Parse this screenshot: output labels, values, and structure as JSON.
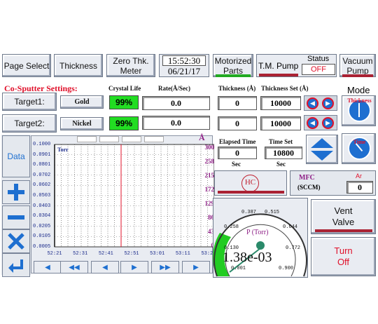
{
  "header": {
    "page_select": "Page Select",
    "thickness": "Thickness",
    "zero_thk_line1": "Zero Thk.",
    "zero_thk_line2": "Meter",
    "time": "15:52:30",
    "date": "06/21/17",
    "motorized_line1": "Motorized",
    "motorized_line2": "Parts",
    "tm_pump": "T.M. Pump",
    "status_label": "Status",
    "status_value": "OFF",
    "vacuum_line1": "Vacuum",
    "vacuum_line2": "Pump"
  },
  "cosputter": {
    "title": "Co-Sputter Settings:",
    "col_crystal_life": "Crystal Life",
    "col_rate": "Rate(Å/Sec)",
    "col_thickness": "Thickness (Å)",
    "col_thickness_set": "Thickness Set (Å)",
    "mode_label": "Mode",
    "mode_thickness_label": "Thickness",
    "targets": [
      {
        "label": "Target1:",
        "material": "Gold",
        "crystal_life": "99%",
        "rate": "0.0",
        "thickness": "0",
        "thickness_set": "10000"
      },
      {
        "label": "Target2:",
        "material": "Nickel",
        "crystal_life": "99%",
        "rate": "0.0",
        "thickness": "0",
        "thickness_set": "10000"
      }
    ]
  },
  "side_buttons": {
    "data": "Data"
  },
  "chart_data": {
    "type": "line",
    "title": "",
    "series": [],
    "ylabel": "Torr",
    "y_ticks": [
      "0.1000",
      "0.0901",
      "0.0801",
      "0.0702",
      "0.0602",
      "0.0503",
      "0.0403",
      "0.0304",
      "0.0205",
      "0.0105",
      "0.0005"
    ],
    "y2_label": "Å",
    "y2_ticks": [
      "300",
      "258",
      "215",
      "172",
      "129",
      "86",
      "43",
      "0"
    ],
    "x_ticks": [
      "52:21",
      "52:31",
      "52:41",
      "52:51",
      "53:01",
      "53:11",
      "53:21"
    ],
    "grid": true
  },
  "timing": {
    "elapsed_label": "Elapsed Time",
    "elapsed_value": "0",
    "elapsed_unit": "Sec",
    "timeset_label": "Time Set",
    "timeset_value": "10800",
    "timeset_unit": "Sec",
    "time_mode_label": "Time"
  },
  "hc_label": "HC",
  "mfc": {
    "label": "MFC",
    "unit": "(SCCM)",
    "gas": "Ar",
    "value": "0"
  },
  "gauge": {
    "label": "P (Torr)",
    "value": "1.38e-03",
    "ticks": [
      "0.001",
      "0.130",
      "0.258",
      "0.387",
      "0.515",
      "0.644",
      "0.772",
      "0.900"
    ]
  },
  "vent_valve": {
    "line1": "Vent",
    "line2": "Valve"
  },
  "turbo": {
    "line1": "Turn",
    "line2": "Off"
  },
  "colors": {
    "accent_red": "#e0102a",
    "green": "#22dd22",
    "purple": "#8e1e86",
    "blue": "#1e6fd0"
  }
}
